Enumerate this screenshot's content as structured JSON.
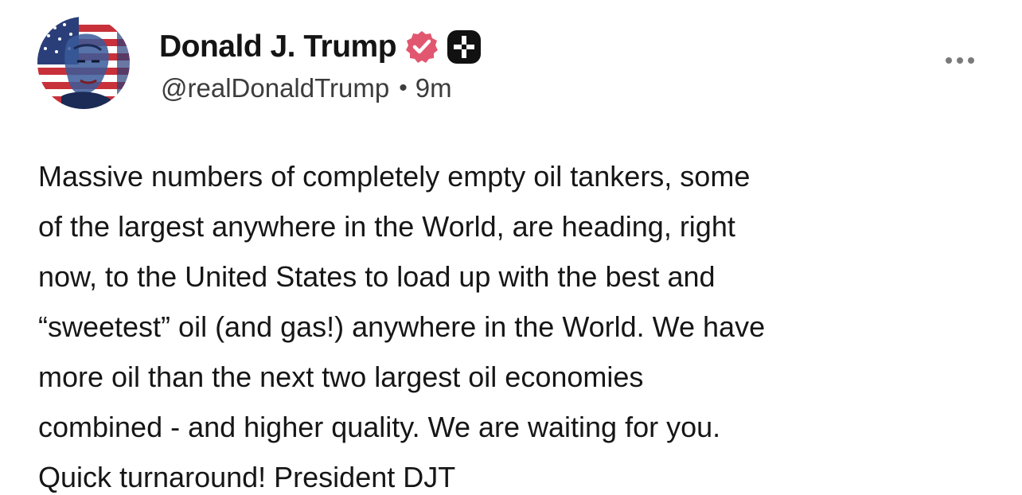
{
  "author": {
    "display_name": "Donald J. Trump",
    "handle": "@realDonaldTrump",
    "separator": "•",
    "timestamp": "9m",
    "avatar_icon": "avatar-flag-portrait",
    "verified_icon": "verified-badge-icon",
    "verified_color": "#e1576f",
    "extra_badge_icon": "plus-badge-icon"
  },
  "menu": {
    "icon": "more-options-icon"
  },
  "post": {
    "lines": [
      "Massive numbers of completely empty oil tankers, some",
      "of the largest anywhere in the World, are heading, right",
      "now, to the United States to load up with the best and",
      "“sweetest” oil (and gas!) anywhere in the World. We have",
      "more oil than the next two largest oil economies",
      "combined - and higher quality. We are waiting for you.",
      "Quick turnaround! President DJT"
    ]
  }
}
